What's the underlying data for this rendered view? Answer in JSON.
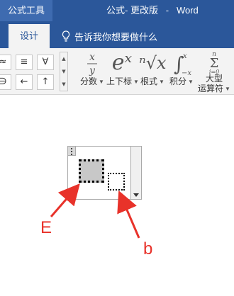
{
  "titlebar": {
    "context_tab": "公式工具",
    "doc_title": "公式- 更改版   -   Word"
  },
  "tabs": {
    "design": "设计",
    "tell_me": "告诉我你想要做什么"
  },
  "ribbon": {
    "symbols": [
      "≈",
      "≡",
      "∀",
      "∋",
      "←",
      "↑"
    ],
    "groups": [
      {
        "label": "分数",
        "icon": "fraction-icon"
      },
      {
        "label": "上下标",
        "icon": "script-icon",
        "glyph": "eˣ"
      },
      {
        "label": "根式",
        "icon": "radical-icon",
        "glyph": "ⁿ√x"
      },
      {
        "label": "积分",
        "icon": "integral-icon",
        "glyph": "∫"
      },
      {
        "label": "大型",
        "label2": "运算符",
        "icon": "sum-icon",
        "glyph": "Σ"
      }
    ]
  },
  "annotations": {
    "base": "E",
    "sub": "b"
  },
  "colors": {
    "ribbon_blue": "#2b579a",
    "annotation_red": "#e8322a"
  }
}
